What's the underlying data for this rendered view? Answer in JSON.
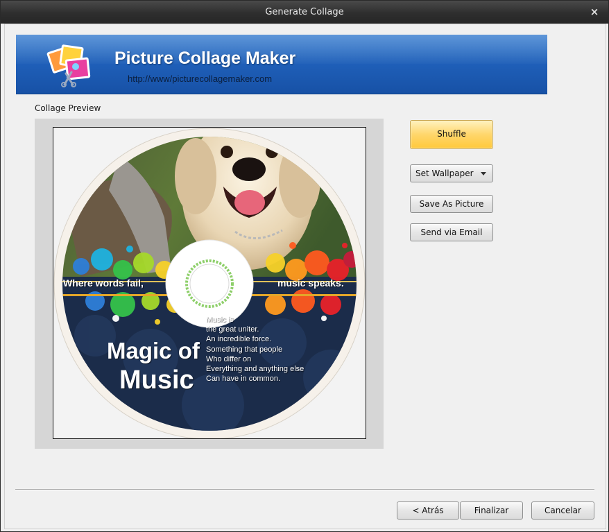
{
  "window": {
    "title": "Generate Collage",
    "close_label": "×"
  },
  "banner": {
    "app_name": "Picture Collage Maker",
    "url": "http://www/picturecollagemaker.com"
  },
  "preview": {
    "label": "Collage Preview",
    "collage_text": {
      "tagline_left": "Where words fail,",
      "tagline_right": "music speaks.",
      "title_line1": "Magic of",
      "title_line2": "Music",
      "poem": [
        "Music is",
        "the great uniter.",
        "An incredible force.",
        "Something that people",
        "Who differ on",
        "Everything and anything else",
        "Can have in common."
      ]
    }
  },
  "actions": {
    "shuffle": "Shuffle",
    "set_wallpaper": "Set Wallpaper",
    "save_as_picture": "Save As Picture",
    "send_via_email": "Send via Email"
  },
  "footer": {
    "back": "< Atrás",
    "finish": "Finalizar",
    "cancel": "Cancelar"
  },
  "colors": {
    "titlebar": "#333333",
    "banner_blue": "#1f5fb8",
    "shuffle_highlight": "#ffd66b"
  }
}
